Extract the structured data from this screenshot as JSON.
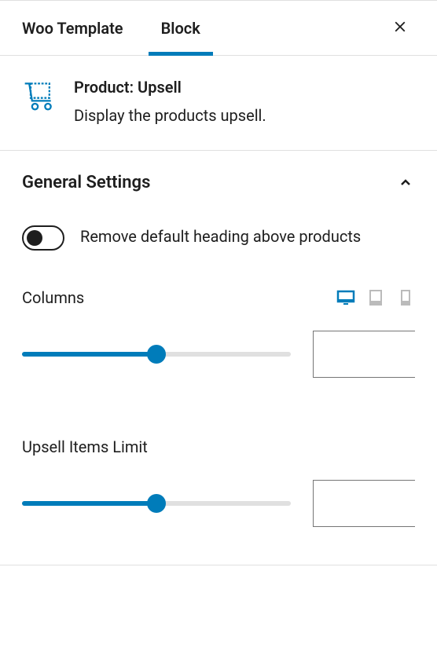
{
  "tabs": {
    "template": "Woo Template",
    "block": "Block"
  },
  "block_header": {
    "title": "Product: Upsell",
    "description": "Display the products upsell."
  },
  "sections": {
    "general": {
      "title": "General Settings",
      "toggle_remove_heading": "Remove default heading above products",
      "columns": {
        "label": "Columns",
        "value": ""
      },
      "upsell_limit": {
        "label": "Upsell Items Limit",
        "value": ""
      }
    }
  }
}
